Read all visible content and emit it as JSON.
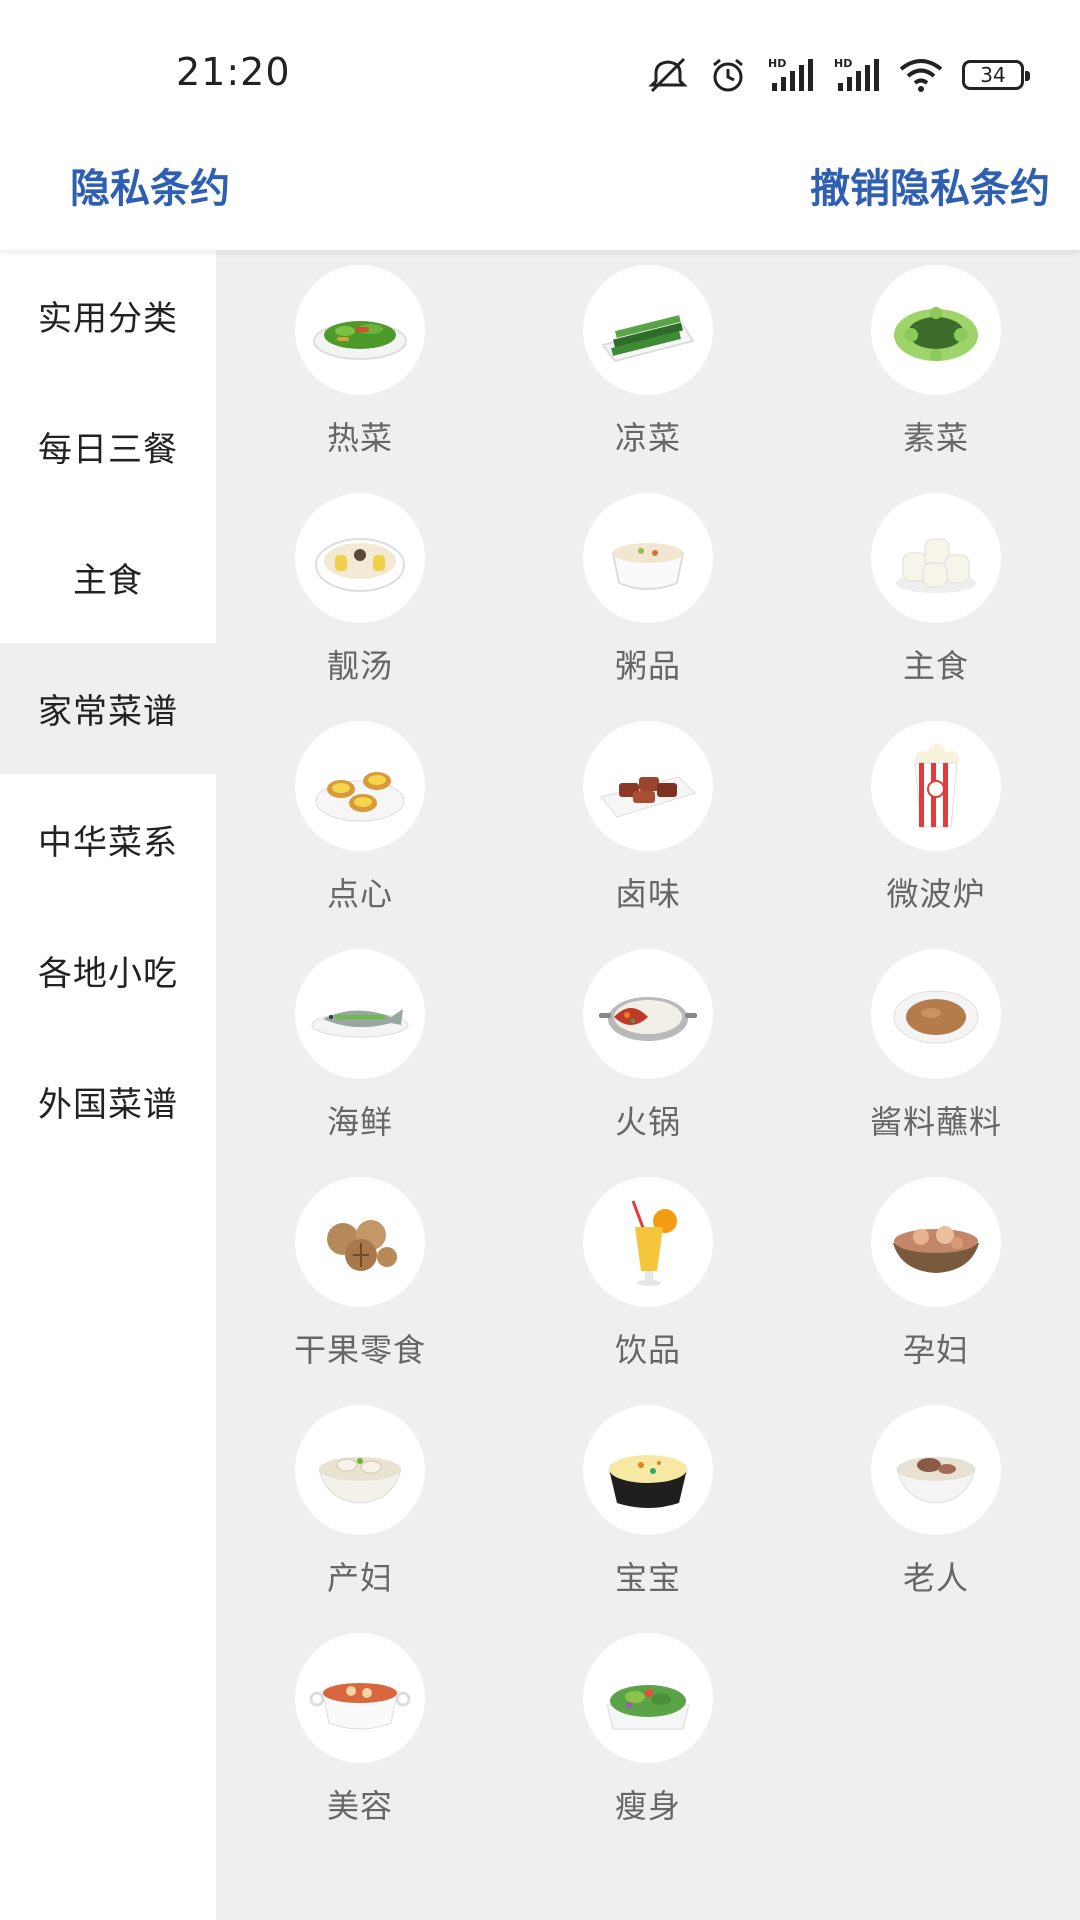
{
  "status_bar": {
    "time": "21:20",
    "battery": "34",
    "icons": [
      "mute-icon",
      "alarm-icon",
      "signal-hd-icon",
      "signal-hd-icon",
      "wifi-icon",
      "battery-icon"
    ]
  },
  "header": {
    "left_link": "隐私条约",
    "right_link": "撤销隐私条约",
    "link_color": "#2f5fb3"
  },
  "sidebar": {
    "items": [
      {
        "label": "实用分类",
        "active": false
      },
      {
        "label": "每日三餐",
        "active": false
      },
      {
        "label": "主食",
        "active": false
      },
      {
        "label": "家常菜谱",
        "active": true
      },
      {
        "label": "中华菜系",
        "active": false
      },
      {
        "label": "各地小吃",
        "active": false
      },
      {
        "label": "外国菜谱",
        "active": false
      }
    ]
  },
  "categories": [
    {
      "label": "热菜",
      "icon": "stir-fry-dish-icon"
    },
    {
      "label": "凉菜",
      "icon": "cucumber-salad-icon"
    },
    {
      "label": "素菜",
      "icon": "greens-dish-icon"
    },
    {
      "label": "靓汤",
      "icon": "corn-soup-icon"
    },
    {
      "label": "粥品",
      "icon": "porridge-bowl-icon"
    },
    {
      "label": "主食",
      "icon": "steamed-buns-icon"
    },
    {
      "label": "点心",
      "icon": "egg-tart-icon"
    },
    {
      "label": "卤味",
      "icon": "braised-meat-icon"
    },
    {
      "label": "微波炉",
      "icon": "popcorn-icon"
    },
    {
      "label": "海鲜",
      "icon": "steamed-fish-icon"
    },
    {
      "label": "火锅",
      "icon": "hot-pot-icon"
    },
    {
      "label": "酱料蘸料",
      "icon": "sauce-bowl-icon"
    },
    {
      "label": "干果零食",
      "icon": "walnuts-icon"
    },
    {
      "label": "饮品",
      "icon": "juice-glass-icon"
    },
    {
      "label": "孕妇",
      "icon": "pregnant-meal-icon"
    },
    {
      "label": "产妇",
      "icon": "postpartum-soup-icon"
    },
    {
      "label": "宝宝",
      "icon": "baby-egg-custard-icon"
    },
    {
      "label": "老人",
      "icon": "elder-soup-icon"
    },
    {
      "label": "美容",
      "icon": "beauty-soup-icon"
    },
    {
      "label": "瘦身",
      "icon": "salad-icon"
    }
  ]
}
